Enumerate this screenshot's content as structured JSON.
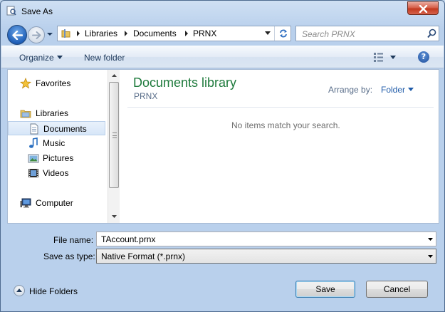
{
  "window": {
    "title": "Save As"
  },
  "address_bar": {
    "crumbs": [
      "Libraries",
      "Documents",
      "PRNX"
    ]
  },
  "search": {
    "placeholder": "Search PRNX"
  },
  "toolbar": {
    "organize_label": "Organize",
    "new_folder_label": "New folder"
  },
  "nav": {
    "items": [
      {
        "label": "Favorites",
        "icon": "star-icon"
      },
      {
        "label": "Libraries",
        "icon": "libraries-icon"
      },
      {
        "label": "Documents",
        "icon": "documents-icon",
        "selected": true
      },
      {
        "label": "Music",
        "icon": "music-icon"
      },
      {
        "label": "Pictures",
        "icon": "pictures-icon"
      },
      {
        "label": "Videos",
        "icon": "videos-icon"
      },
      {
        "label": "Computer",
        "icon": "computer-icon"
      }
    ]
  },
  "main": {
    "library_title": "Documents library",
    "library_subtitle": "PRNX",
    "arrange_label": "Arrange by:",
    "arrange_value": "Folder",
    "empty_message": "No items match your search."
  },
  "form": {
    "file_name_label": "File name:",
    "file_name_value": "TAccount.prnx",
    "save_type_label": "Save as type:",
    "save_type_value": "Native Format (*.prnx)"
  },
  "footer": {
    "hide_folders_label": "Hide Folders",
    "save_label": "Save",
    "cancel_label": "Cancel"
  },
  "colors": {
    "accent": "#1e7a3c",
    "link": "#1e5aa8",
    "close": "#c23a1f"
  }
}
